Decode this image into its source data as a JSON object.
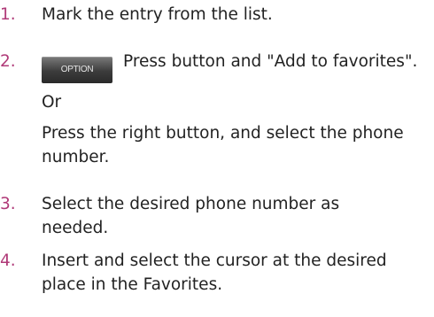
{
  "steps": [
    {
      "number": "1.",
      "text": "Mark the entry from the list."
    },
    {
      "number": "2.",
      "button_label": "OPTION",
      "text": "Press button and \"Add to favorites\".",
      "alt_word": "Or",
      "alt_text": "Press the right button, and select the phone number."
    },
    {
      "number": "3.",
      "text": "Select the desired phone number as needed."
    },
    {
      "number": "4.",
      "text": "Insert and select the cursor at the desired place in the Favorites."
    }
  ],
  "colors": {
    "step_number": "#b03a78",
    "text": "#222222",
    "option_button": "#3c3c3c"
  }
}
